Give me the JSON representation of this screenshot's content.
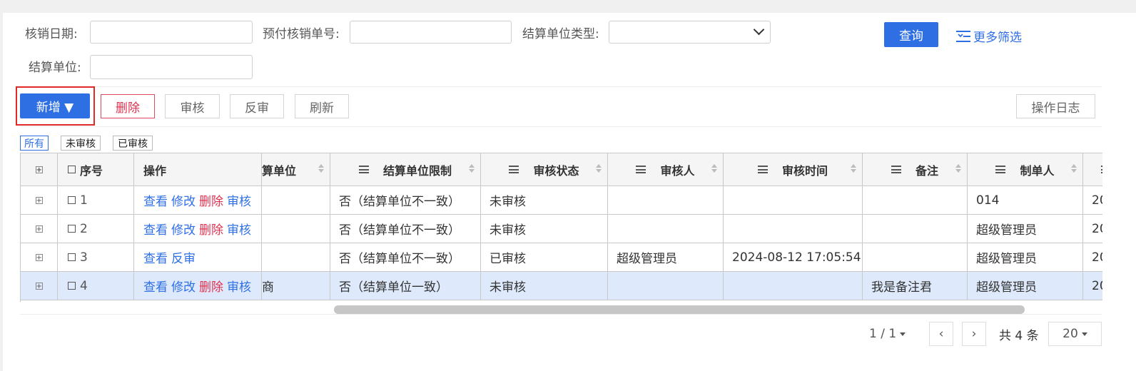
{
  "filters": {
    "write_off_date_label": "核销日期:",
    "write_off_date_value": "",
    "prepay_no_label": "预付核销单号:",
    "prepay_no_value": "",
    "unit_type_label": "结算单位类型:",
    "unit_type_value": "",
    "unit_label": "结算单位:",
    "unit_value": "",
    "query_label": "查询",
    "more_label": "更多筛选"
  },
  "toolbar": {
    "add_label": "新增 ▼",
    "delete_label": "删除",
    "audit_label": "审核",
    "unaudit_label": "反审",
    "refresh_label": "刷新",
    "log_label": "操作日志"
  },
  "tabs": [
    "所有",
    "未审核",
    "已审核"
  ],
  "table": {
    "headers": {
      "seq": "序号",
      "op": "操作",
      "unit": "算单位",
      "limit": "结算单位限制",
      "status": "审核状态",
      "auditor": "审核人",
      "audit_time": "审核时间",
      "remark": "备注",
      "creator": "制单人"
    },
    "rows": [
      {
        "seq": "1",
        "actions": [
          "查看",
          "修改",
          "删除",
          "审核"
        ],
        "unit": "",
        "limit": "否（结算单位不一致）",
        "status": "未审核",
        "auditor": "",
        "audit_time": "",
        "remark": "",
        "creator": "014",
        "extra": "20"
      },
      {
        "seq": "2",
        "actions": [
          "查看",
          "修改",
          "删除",
          "审核"
        ],
        "unit": "",
        "limit": "否（结算单位不一致）",
        "status": "未审核",
        "auditor": "",
        "audit_time": "",
        "remark": "",
        "creator": "超级管理员",
        "extra": "20"
      },
      {
        "seq": "3",
        "actions": [
          "查看",
          "反审"
        ],
        "unit": "",
        "limit": "否（结算单位不一致）",
        "status": "已审核",
        "auditor": "超级管理员",
        "audit_time": "2024-08-12 17:05:54",
        "remark": "",
        "creator": "超级管理员",
        "extra": "20"
      },
      {
        "seq": "4",
        "actions": [
          "查看",
          "修改",
          "删除",
          "审核"
        ],
        "unit": "商",
        "limit": "否（结算单位一致）",
        "status": "未审核",
        "auditor": "",
        "audit_time": "",
        "remark": "我是备注君",
        "creator": "超级管理员",
        "extra": "20"
      }
    ]
  },
  "pager": {
    "page": "1 / 1",
    "prev": "‹",
    "next": "›",
    "total": "共 4 条",
    "page_size": "20"
  },
  "colors": {
    "accent": "#2f6fe4",
    "danger": "#e0324f",
    "highlight": "#e02a2a"
  }
}
